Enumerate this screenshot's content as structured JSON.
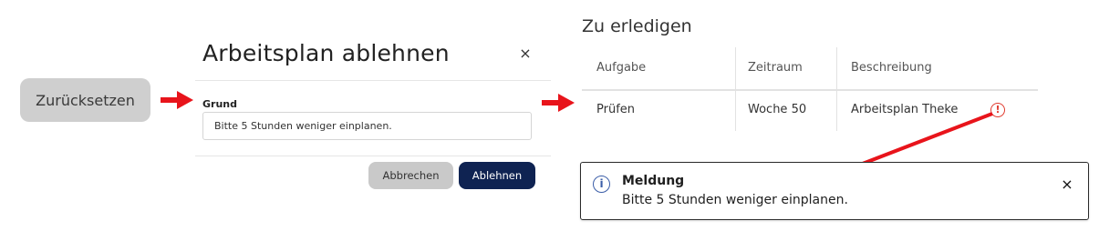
{
  "reset_button": {
    "label": "Zurücksetzen"
  },
  "dialog": {
    "title": "Arbeitsplan ablehnen",
    "close_glyph": "×",
    "field_label": "Grund",
    "field_value": "Bitte 5 Stunden weniger einplanen.",
    "cancel_label": "Abbrechen",
    "reject_label": "Ablehnen"
  },
  "todo": {
    "title": "Zu erledigen",
    "columns": [
      "Aufgabe",
      "Zeitraum",
      "Beschreibung"
    ],
    "rows": [
      {
        "task": "Prüfen",
        "period": "Woche 50",
        "description": "Arbeitsplan Theke",
        "warn_glyph": "!"
      }
    ]
  },
  "toast": {
    "info_glyph": "i",
    "title": "Meldung",
    "message": "Bitte 5 Stunden weniger einplanen.",
    "close_glyph": "×"
  },
  "colors": {
    "arrow_red": "#e8141b",
    "primary_navy": "#0f2352",
    "warning_red": "#e03a2e",
    "info_blue": "#3b5ea8"
  },
  "icons": [
    "arrow-right-icon",
    "close-icon",
    "warning-icon",
    "info-icon",
    "connector-arrow-icon"
  ]
}
